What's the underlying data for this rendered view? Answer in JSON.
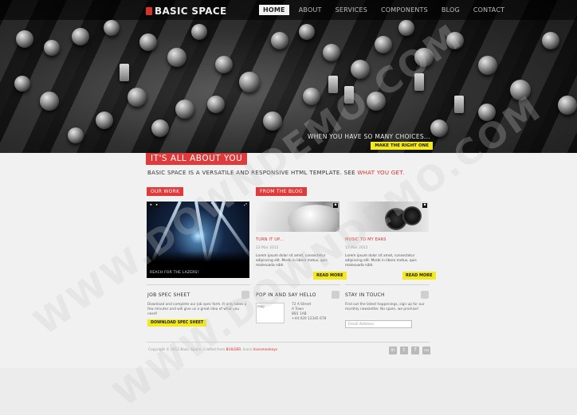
{
  "header": {
    "logo_text": "BASIC SPACE",
    "nav": [
      "HOME",
      "ABOUT",
      "SERVICES",
      "COMPONENTS",
      "BLOG",
      "CONTACT"
    ],
    "active_nav": "HOME"
  },
  "hero": {
    "tagline": "WHEN YOU HAVE SO MANY CHOICES...",
    "button": "MAKE THE RIGHT ONE"
  },
  "intro": {
    "headline": "IT'S ALL ABOUT YOU",
    "text": "BASIC SPACE IS A VERSATILE AND RESPONSIVE HTML TEMPLATE. SEE",
    "highlight": "WHAT YOU GET."
  },
  "our_work": {
    "label": "OUR WORK",
    "caption": "REACH FOR THE LAZERS!"
  },
  "blog": {
    "label": "FROM THE BLOG",
    "posts": [
      {
        "title": "TURN IT UP...",
        "date": "22 Mar 2012",
        "body": "Lorem ipsum dolor sit amet, consectetur adipiscing elit. Morbi in libero metus, quis malesuada nibh.",
        "button": "READ MORE"
      },
      {
        "title": "MUSIC TO MY EARS",
        "date": "15 Mar 2012",
        "body": "Lorem ipsum dolor sit amet, consectetur adipiscing elit. Morbi in libero metus, quis malesuada nibh.",
        "button": "READ MORE"
      }
    ]
  },
  "columns": {
    "job": {
      "title": "JOB SPEC SHEET",
      "body": "Download and complete our job spec form. It only takes a few minutes and will give us a great idea of what you need!",
      "button": "DOWNLOAD SPEC SHEET"
    },
    "contact": {
      "title": "POP IN AND SAY HELLO",
      "map_alt": "map",
      "address": [
        "72 A Street",
        "A Town",
        "BB1 1AB",
        "+44 020 12345 678"
      ]
    },
    "touch": {
      "title": "STAY IN TOUCH",
      "body": "Find out the latest happenings, sign up for our monthly newsletter. No spam, we promise!",
      "email_placeholder": "Email Address"
    }
  },
  "footer": {
    "text": "Copyright © 2012 Basic Space. Crafted from",
    "link1": "BUILDER",
    "mid": ". Icons",
    "link2": "Iconsmonkeys",
    "social": [
      "in",
      "t",
      "f",
      "rss"
    ]
  },
  "watermark": "WWW.DOWNDEMO.COM"
}
